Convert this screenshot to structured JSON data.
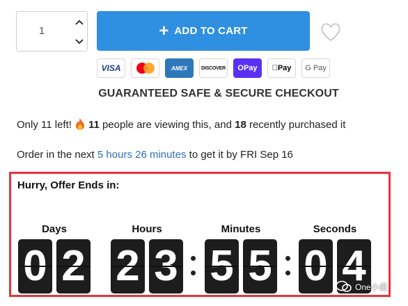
{
  "quantity": {
    "value": "1"
  },
  "cart": {
    "label": "ADD TO CART",
    "plus": "+"
  },
  "payments": [
    {
      "name": "visa",
      "label": "VISA"
    },
    {
      "name": "mastercard",
      "label": ""
    },
    {
      "name": "amex",
      "label": "AMEX"
    },
    {
      "name": "discover",
      "label": "DISCOVER"
    },
    {
      "name": "shop-pay",
      "label": "OPay"
    },
    {
      "name": "apple-pay",
      "label": "Pay"
    },
    {
      "name": "google-pay",
      "label": "G Pay"
    }
  ],
  "secure_text": "GUARANTEED SAFE & SECURE CHECKOUT",
  "stock": {
    "prefix": "Only 11 left!",
    "viewers": "11",
    "viewers_text": "people are viewing this, and",
    "purchased": "18",
    "purchased_text": "recently purchased it"
  },
  "order": {
    "prefix": "Order in the next",
    "time": "5 hours 26 minutes",
    "suffix": "to get it by FRI Sep 16"
  },
  "countdown": {
    "title": "Hurry, Offer Ends in:",
    "units": [
      {
        "label": "Days",
        "digits": [
          "0",
          "2"
        ]
      },
      {
        "label": "Hours",
        "digits": [
          "2",
          "3"
        ]
      },
      {
        "label": "Minutes",
        "digits": [
          "5",
          "5"
        ]
      },
      {
        "label": "Seconds",
        "digits": [
          "0",
          "4"
        ]
      }
    ]
  },
  "watermark": {
    "text": "One小目"
  },
  "colors": {
    "accent": "#2f8fe0",
    "timer_border": "#e8323e",
    "highlight": "#2f6fbf",
    "digit_bg": "#1d1d1d"
  }
}
